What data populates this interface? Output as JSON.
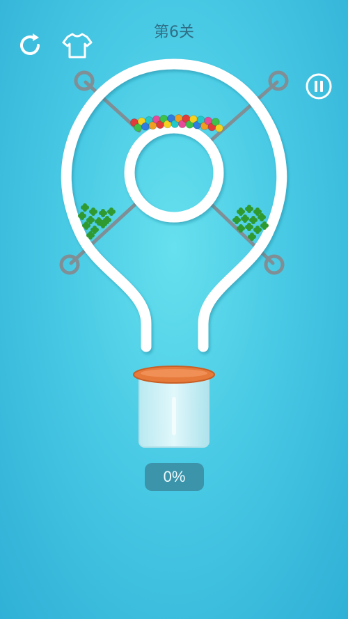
{
  "header": {
    "level_title": "第6关",
    "restart_icon": "restart-icon",
    "skin_icon": "tshirt-icon",
    "pause_icon": "pause-icon"
  },
  "progress": {
    "text": "0%",
    "value": 0
  },
  "colors": {
    "background": "#48c9e4",
    "tube": "#ffffff",
    "pin": "#7f8f95",
    "cup_rim": "#e57a3b",
    "cup_glass": "#d9f2f6",
    "ball_colors": [
      "#e23b3b",
      "#f0a020",
      "#2f7de0",
      "#3cc24a",
      "#e84a9a",
      "#21c9c9",
      "#f5d21f"
    ],
    "clover": "#2f9a2f"
  },
  "game": {
    "pins": 4,
    "ball_count": 24,
    "clover_piles": 2
  }
}
